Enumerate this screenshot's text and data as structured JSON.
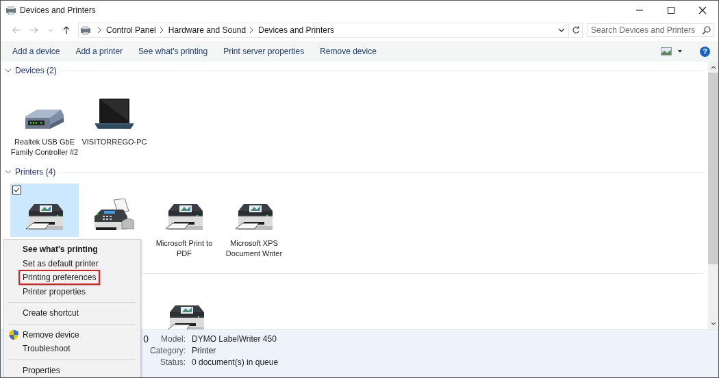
{
  "window": {
    "title": "Devices and Printers"
  },
  "address": {
    "breadcrumbs": [
      "Control Panel",
      "Hardware and Sound",
      "Devices and Printers"
    ],
    "search_placeholder": "Search Devices and Printers"
  },
  "commands": [
    "Add a device",
    "Add a printer",
    "See what's printing",
    "Print server properties",
    "Remove device"
  ],
  "help": "?",
  "sections": [
    {
      "title": "Devices (2)",
      "expanded": true,
      "items": [
        {
          "kind": "router",
          "label": "Realtek USB GbE Family Controller #2",
          "selected": false
        },
        {
          "kind": "laptop",
          "label": "VISITORREGO-PC",
          "selected": false
        }
      ]
    },
    {
      "title": "Printers (4)",
      "expanded": true,
      "items": [
        {
          "kind": "printer",
          "selected": true,
          "checked": true
        },
        {
          "kind": "fax",
          "selected": false
        },
        {
          "kind": "printer",
          "label": "Microsoft Print to PDF",
          "selected": false
        },
        {
          "kind": "printer",
          "label": "Microsoft XPS Document Writer",
          "selected": false
        }
      ]
    },
    {
      "items": [
        {
          "kind": "printer",
          "selected": false
        }
      ]
    }
  ],
  "context_menu": [
    {
      "kind": "item",
      "label": "See what's printing",
      "default": true
    },
    {
      "kind": "item",
      "label": "Set as default printer"
    },
    {
      "kind": "item",
      "label": "Printing preferences",
      "highlighted": true
    },
    {
      "kind": "item",
      "label": "Printer properties"
    },
    {
      "kind": "separator"
    },
    {
      "kind": "item",
      "label": "Create shortcut"
    },
    {
      "kind": "separator"
    },
    {
      "kind": "admin_item",
      "label": "Remove device"
    },
    {
      "kind": "item",
      "label": "Troubleshoot"
    },
    {
      "kind": "separator"
    },
    {
      "kind": "item",
      "label": "Properties"
    }
  ],
  "details": {
    "name": "0",
    "fields": [
      {
        "label": "Model:",
        "value": "DYMO LabelWriter 450"
      },
      {
        "label": "Category:",
        "value": "Printer"
      },
      {
        "label": "Status:",
        "value": "0 document(s) in queue"
      }
    ]
  }
}
